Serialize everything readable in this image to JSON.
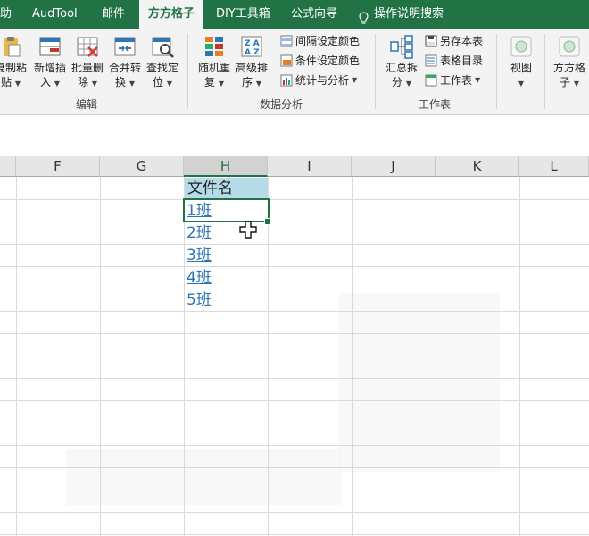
{
  "ribbon_tabs": [
    {
      "label": "助"
    },
    {
      "label": "AudTool"
    },
    {
      "label": "邮件"
    },
    {
      "label": "方方格子",
      "active": true
    },
    {
      "label": "DIY工具箱"
    },
    {
      "label": "公式向导"
    },
    {
      "label": "操作说明搜索"
    }
  ],
  "ribbon": {
    "edit": {
      "copy_paste": [
        "复制粘",
        "贴"
      ],
      "insert": [
        "新增插",
        "入"
      ],
      "batch_delete": [
        "批量删",
        "除"
      ],
      "merge_convert": [
        "合并转",
        "换"
      ],
      "find_locate": [
        "查找定",
        "位"
      ],
      "group_label": "编辑"
    },
    "analysis": {
      "random_repeat": [
        "随机重",
        "复"
      ],
      "advanced_sort": [
        "高级排",
        "序"
      ],
      "interval_color": "间隔设定颜色",
      "condition_color": "条件设定颜色",
      "stats_analysis": "统计与分析",
      "group_label": "数据分析"
    },
    "worksheet": {
      "summary_split": [
        "汇总拆",
        "分"
      ],
      "save_as": "另存本表",
      "table_directory": "表格目录",
      "worksheet": "工作表",
      "group_label": "工作表"
    },
    "view": {
      "label": "视图"
    },
    "ffgz": {
      "label": [
        "方方格",
        "子"
      ]
    }
  },
  "columns": [
    "F",
    "G",
    "H",
    "I",
    "J",
    "K",
    "L"
  ],
  "selected_column": "H",
  "cells": {
    "header": "文件名",
    "links": [
      "1班",
      "2班",
      "3班",
      "4班",
      "5班"
    ]
  },
  "colors": {
    "brand": "#217346",
    "link": "#2e75b6",
    "header_fill": "#b4dbe7"
  }
}
